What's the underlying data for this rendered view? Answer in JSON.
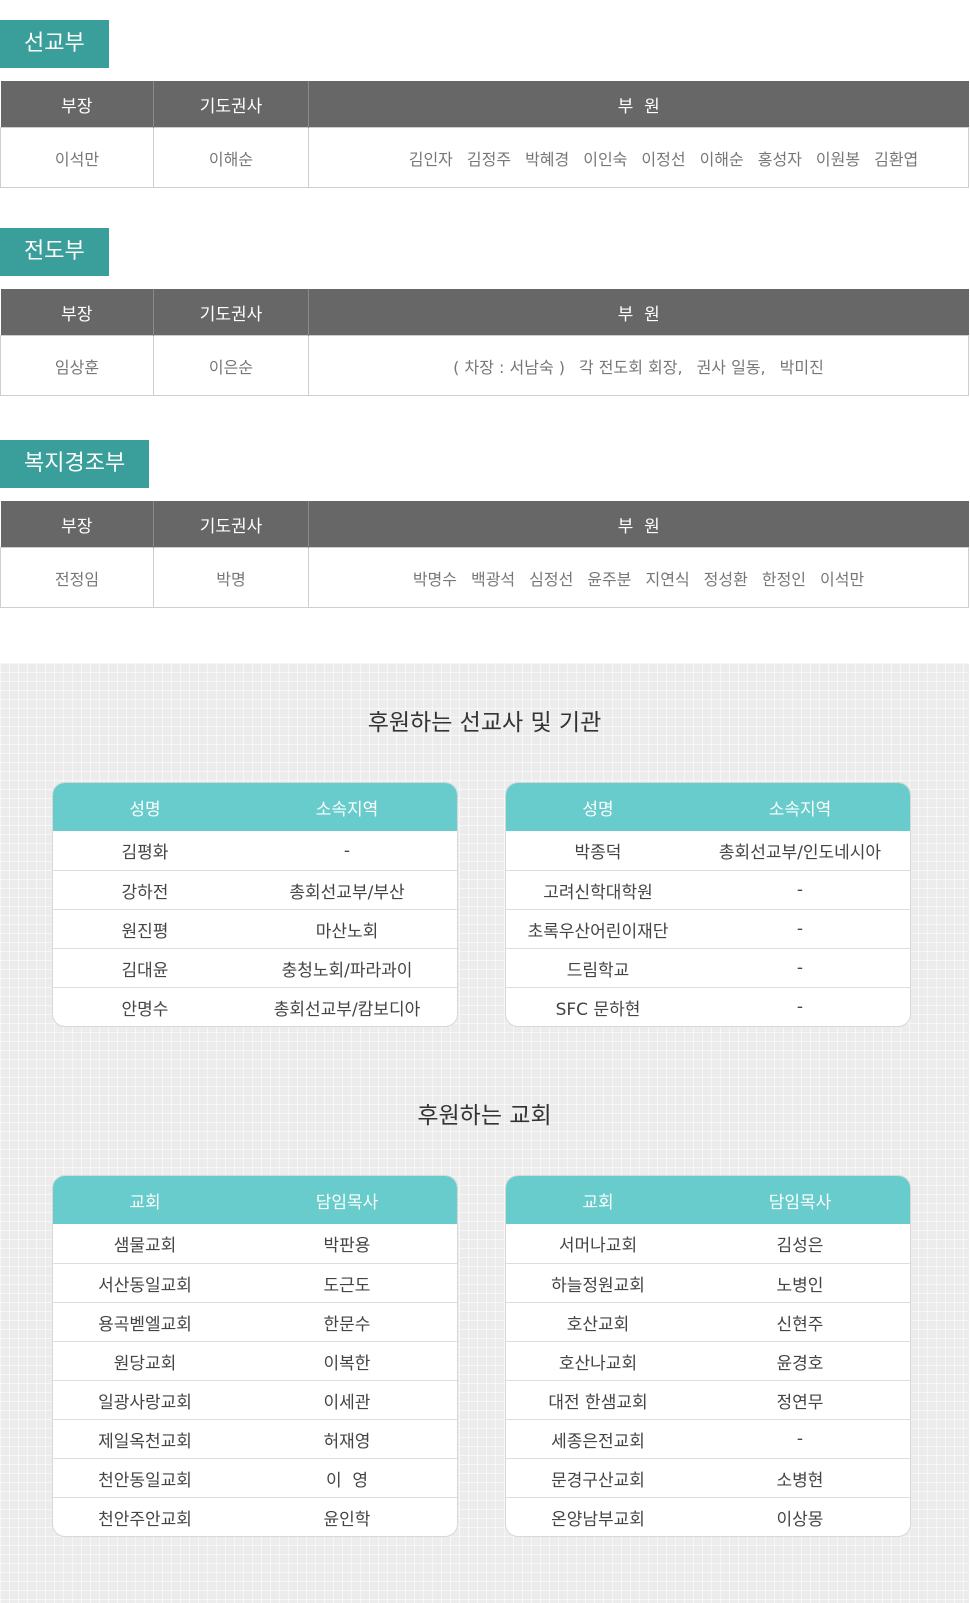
{
  "departments": [
    {
      "title": "선교부",
      "headers": {
        "head": "부장",
        "deacon": "기도권사",
        "members": "부  원"
      },
      "head": "이석만",
      "deacon": "이해순",
      "members": [
        "김인자",
        "김정주",
        "박혜경",
        "이인숙",
        "이정선",
        "이해순",
        "홍성자",
        "이원봉",
        "김환엽"
      ]
    },
    {
      "title": "전도부",
      "headers": {
        "head": "부장",
        "deacon": "기도권사",
        "members": "부  원"
      },
      "head": "임상훈",
      "deacon": "이은순",
      "members": [
        "( 차장 : 서남숙 )",
        "각 전도회 회장,",
        "권사 일동,",
        "박미진"
      ]
    },
    {
      "title": "복지경조부",
      "headers": {
        "head": "부장",
        "deacon": "기도권사",
        "members": "부  원"
      },
      "head": "전정임",
      "deacon": "박명",
      "members": [
        "박명수",
        "백광석",
        "심정선",
        "윤주분",
        "지연식",
        "정성환",
        "한정인",
        "이석만"
      ]
    }
  ],
  "missionaries": {
    "title": "후원하는 선교사 및 기관",
    "headers": {
      "name": "성명",
      "region": "소속지역"
    },
    "left": [
      {
        "name": "김평화",
        "region": "-"
      },
      {
        "name": "강하전",
        "region": "총회선교부/부산"
      },
      {
        "name": "원진평",
        "region": "마산노회"
      },
      {
        "name": "김대윤",
        "region": "충청노회/파라과이"
      },
      {
        "name": "안명수",
        "region": "총회선교부/캄보디아"
      }
    ],
    "right": [
      {
        "name": "박종덕",
        "region": "총회선교부/인도네시아"
      },
      {
        "name": "고려신학대학원",
        "region": "-"
      },
      {
        "name": "초록우산어린이재단",
        "region": "-"
      },
      {
        "name": "드림학교",
        "region": "-"
      },
      {
        "name": "SFC 문하현",
        "region": "-"
      }
    ]
  },
  "churches": {
    "title": "후원하는 교회",
    "headers": {
      "church": "교회",
      "pastor": "담임목사"
    },
    "left": [
      {
        "church": "샘물교회",
        "pastor": "박판용"
      },
      {
        "church": "서산동일교회",
        "pastor": "도근도"
      },
      {
        "church": "용곡벧엘교회",
        "pastor": "한문수"
      },
      {
        "church": "원당교회",
        "pastor": "이복한"
      },
      {
        "church": "일광사랑교회",
        "pastor": "이세관"
      },
      {
        "church": "제일옥천교회",
        "pastor": "허재영"
      },
      {
        "church": "천안동일교회",
        "pastor": "이  영"
      },
      {
        "church": "천안주안교회",
        "pastor": "윤인학"
      }
    ],
    "right": [
      {
        "church": "서머나교회",
        "pastor": "김성은"
      },
      {
        "church": "하늘정원교회",
        "pastor": "노병인"
      },
      {
        "church": "호산교회",
        "pastor": "신현주"
      },
      {
        "church": "호산나교회",
        "pastor": "윤경호"
      },
      {
        "church": "대전 한샘교회",
        "pastor": "정연무"
      },
      {
        "church": "세종은전교회",
        "pastor": "-"
      },
      {
        "church": "문경구산교회",
        "pastor": "소병현"
      },
      {
        "church": "온양남부교회",
        "pastor": "이상몽"
      }
    ]
  },
  "colors": {
    "title_bg": "#3a9e9a",
    "table_head_bg": "#676767",
    "card_head_bg": "#67cccb"
  }
}
